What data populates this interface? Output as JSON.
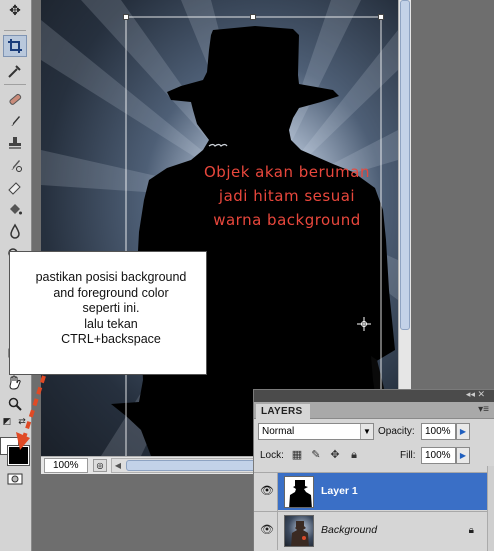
{
  "document": {
    "zoom_label": "100%",
    "caption_lines": [
      "Objek akan beruman",
      "jadi hitam sesuai",
      "warna background"
    ]
  },
  "callout": {
    "text": "pastikan posisi background\nand foreground color\nseperti ini.\nlalu tekan\nCTRL+backspace"
  },
  "colors": {
    "foreground": "#000000",
    "background": "#ffffff",
    "caption": "#e8473c",
    "arrow": "#e04a25",
    "selected_layer": "#3a6fc6"
  },
  "tools": {
    "icons": [
      "move-icon",
      "crop-icon",
      "eyedropper-icon",
      "healing-brush-icon",
      "brush-icon",
      "clone-stamp-icon",
      "history-brush-icon",
      "eraser-icon",
      "paint-bucket-icon",
      "blur-icon",
      "dodge-icon",
      "pen-icon",
      "type-icon",
      "path-selection-icon",
      "shape-icon",
      "hand-icon",
      "zoom-icon",
      "swap-colors-icon",
      "default-colors-icon",
      "quick-mask-icon"
    ]
  },
  "layers_panel": {
    "tab_label": "LAYERS",
    "blend_mode": "Normal",
    "opacity_label": "Opacity:",
    "opacity_value": "100%",
    "lock_label": "Lock:",
    "fill_label": "Fill:",
    "fill_value": "100%",
    "layers": [
      {
        "name": "Layer 1",
        "selected": true,
        "visible": true,
        "locked": false
      },
      {
        "name": "Background",
        "selected": false,
        "visible": true,
        "locked": true
      }
    ]
  }
}
